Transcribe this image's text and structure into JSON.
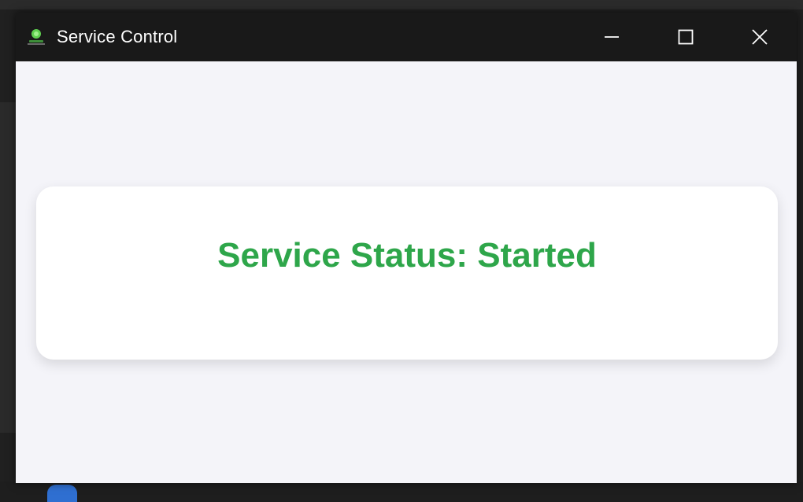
{
  "window": {
    "title": "Service Control",
    "icon": "app-logo-icon"
  },
  "caption": {
    "minimize": "minimize-icon",
    "maximize": "maximize-icon",
    "close": "close-icon"
  },
  "status": {
    "text": "Service Status: Started",
    "color": "#2ea64a"
  },
  "colors": {
    "titlebar": "#191919",
    "window_bg": "#f4f4f9",
    "card_bg": "#ffffff"
  }
}
